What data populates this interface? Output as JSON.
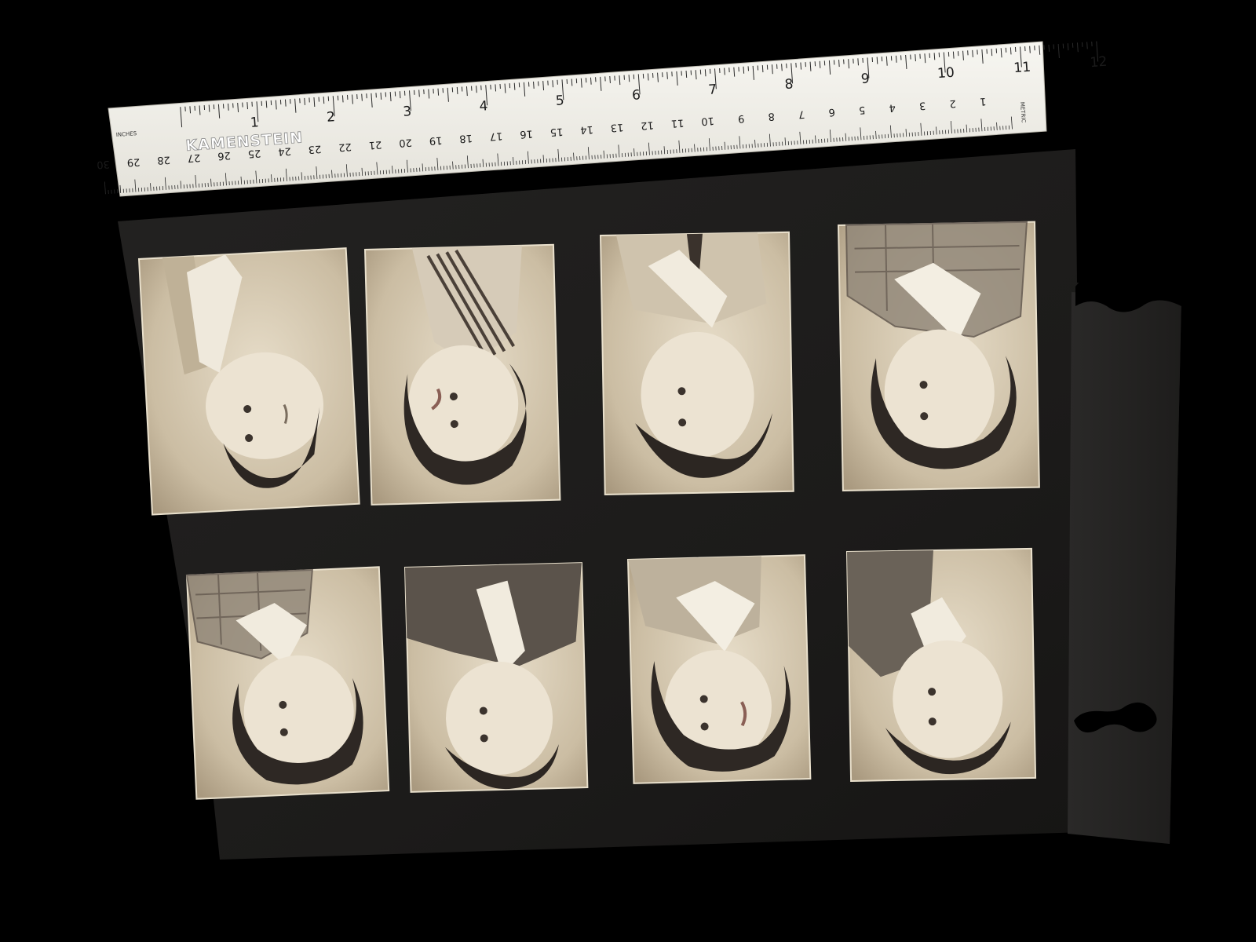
{
  "ruler": {
    "brand": "KAMENSTEIN",
    "inches_label": "INCHES",
    "metric_label": "METRIC",
    "inch_marks": [
      "1",
      "2",
      "3",
      "4",
      "5",
      "6",
      "7",
      "8",
      "9",
      "10",
      "11",
      "12"
    ],
    "cm_marks": [
      "1",
      "2",
      "3",
      "4",
      "5",
      "6",
      "7",
      "8",
      "9",
      "10",
      "11",
      "12",
      "13",
      "14",
      "15",
      "16",
      "17",
      "18",
      "19",
      "20",
      "21",
      "22",
      "23",
      "24",
      "25",
      "26",
      "27",
      "28",
      "29",
      "30"
    ]
  },
  "album_page": {
    "photos": [
      {
        "row": 1,
        "col": 1,
        "subject": "man",
        "attire": "light suit, white collar, dark tie"
      },
      {
        "row": 1,
        "col": 2,
        "subject": "woman",
        "attire": "striped blouse"
      },
      {
        "row": 1,
        "col": 3,
        "subject": "man",
        "attire": "light suit, white collar, dark tie"
      },
      {
        "row": 1,
        "col": 4,
        "subject": "woman",
        "attire": "checked jacket, white collar"
      },
      {
        "row": 2,
        "col": 1,
        "subject": "woman",
        "attire": "plaid jacket, white collar"
      },
      {
        "row": 2,
        "col": 2,
        "subject": "man",
        "attire": "dark suit, white collar"
      },
      {
        "row": 2,
        "col": 3,
        "subject": "woman",
        "attire": "light jacket, white collar"
      },
      {
        "row": 2,
        "col": 4,
        "subject": "man",
        "attire": "dark suit, white collar"
      }
    ]
  },
  "colors": {
    "background": "#000000",
    "album_paper": "#1c1b1a",
    "ruler": "#f1f0ea",
    "photo_sepia": "#d8cbb4"
  }
}
